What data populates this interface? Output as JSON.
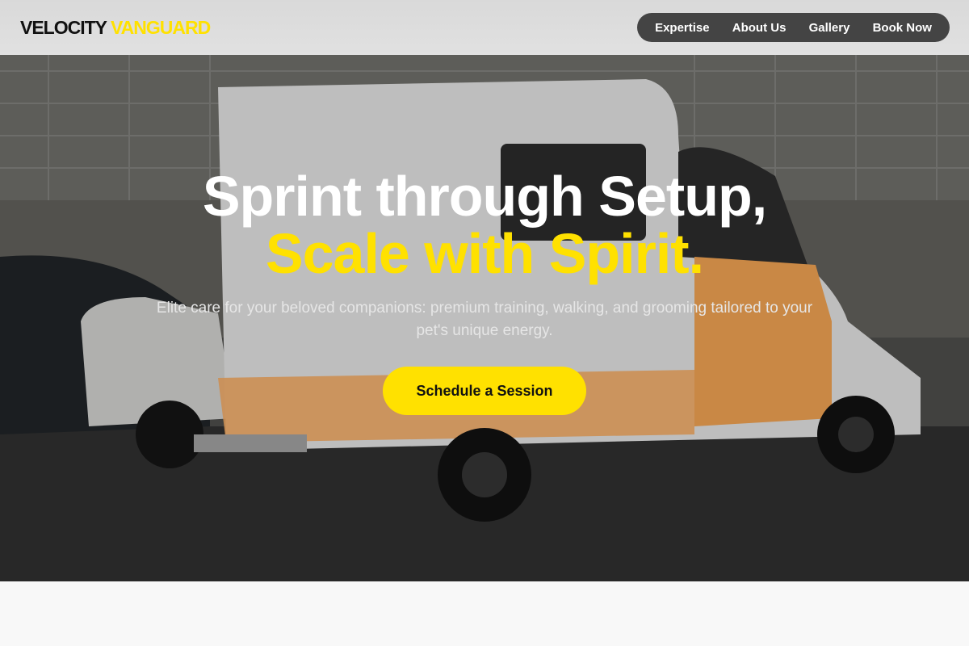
{
  "brand": {
    "part1": "VELOCITY",
    "part2": "VANGUARD"
  },
  "nav": {
    "items": [
      {
        "label": "Expertise"
      },
      {
        "label": "About Us"
      },
      {
        "label": "Gallery"
      },
      {
        "label": "Book Now"
      }
    ]
  },
  "hero": {
    "headline_line1": "Sprint through Setup,",
    "headline_line2": "Scale with Spirit.",
    "subtitle": "Elite care for your beloved companions: premium training, walking, and grooming tailored to your pet's unique energy.",
    "cta_label": "Schedule a Session",
    "background_image": "van-photo",
    "accent_color": "#ffe100"
  }
}
